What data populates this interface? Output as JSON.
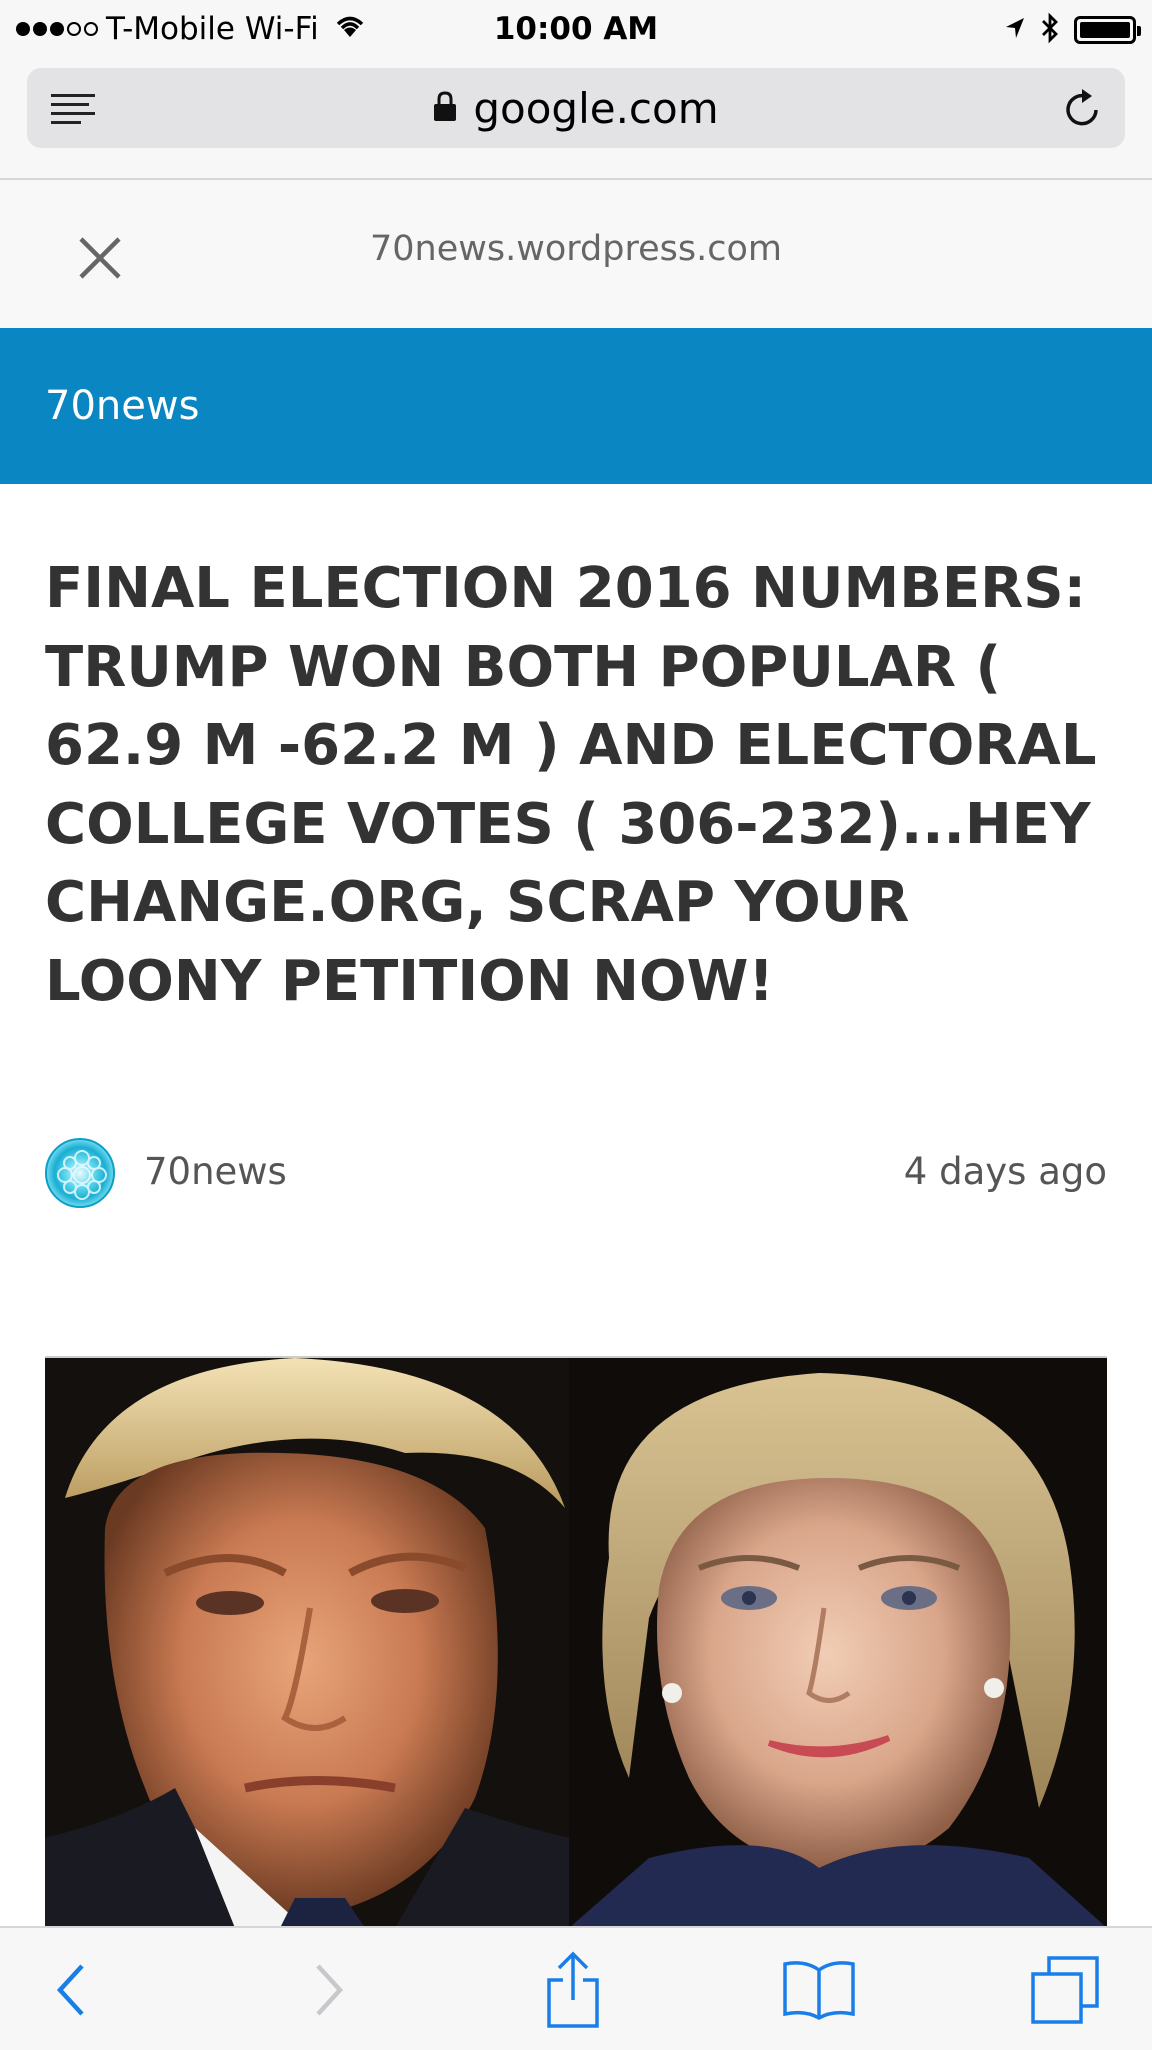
{
  "status_bar": {
    "carrier": "T-Mobile Wi-Fi",
    "time": "10:00 AM",
    "signal_bars_filled": 3,
    "signal_bars_total": 5,
    "icons": [
      "wifi-icon",
      "location-arrow-icon",
      "bluetooth-icon",
      "battery-icon"
    ]
  },
  "browser": {
    "url_display": "google.com",
    "icons": [
      "reader-view-icon",
      "lock-icon",
      "reload-icon"
    ]
  },
  "viewer": {
    "domain": "70news.wordpress.com",
    "icons": [
      "close-icon"
    ]
  },
  "site": {
    "name": "70news",
    "brand_color": "#0a87c2"
  },
  "article": {
    "headline": "FINAL ELECTION 2016 NUMBERS: TRUMP WON BOTH POPULAR ( 62.9 M -62.2 M ) AND ELECTORAL COLLEGE VOTES ( 306-232)...HEY CHANGE.ORG, SCRAP YOUR LOONY PETITION NOW!",
    "author": "70news",
    "posted": "4 days ago"
  },
  "toolbar": {
    "icons": [
      "back-icon",
      "forward-icon",
      "share-icon",
      "bookmarks-icon",
      "tabs-icon"
    ],
    "accent_color": "#1a7ee8"
  }
}
